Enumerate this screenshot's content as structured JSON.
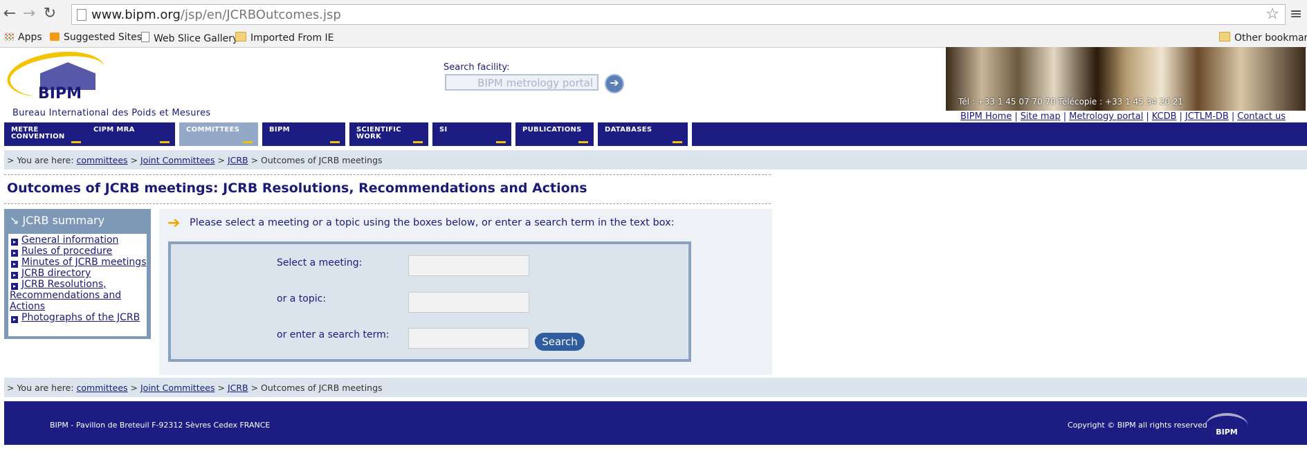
{
  "browser": {
    "url_domain": "www.bipm.org",
    "url_path": "/jsp/en/JCRBOutcomes.jsp",
    "bookmarks": [
      "Apps",
      "Suggested Sites",
      "Web Slice Gallery",
      "Imported From IE"
    ],
    "other_bookmarks": "Other bookmarks"
  },
  "header": {
    "logo_text": "BIPM",
    "bureau_name": "Bureau International des Poids et Mesures",
    "search_label": "Search facility:",
    "search_placeholder": "BIPM metrology portal",
    "banner_contact": "Tél : +33 1 45 07 70 70  Télécopie : +33 1 45 34 20 21",
    "top_links": [
      "BIPM Home",
      "Site map",
      "Metrology portal",
      "KCDB",
      "JCTLM-DB",
      "Contact us"
    ]
  },
  "nav": {
    "items": [
      "METRE\nCONVENTION",
      "CIPM MRA",
      "COMMITTEES",
      "BIPM",
      "SCIENTIFIC\nWORK",
      "SI",
      "PUBLICATIONS",
      "DATABASES"
    ],
    "active": "COMMITTEES"
  },
  "breadcrumb": {
    "prefix": "> You are here:",
    "links": [
      "committees",
      "Joint Committees",
      "JCRB"
    ],
    "current": "Outcomes of JCRB meetings"
  },
  "page_title": "Outcomes of JCRB meetings: JCRB Resolutions, Recommendations and Actions",
  "sidebar": {
    "title": "JCRB summary",
    "items": [
      "General information",
      "Rules of procedure",
      "Minutes of JCRB meetings",
      "JCRB directory",
      "JCRB Resolutions, Recommendations and Actions",
      "Photographs of the JCRB"
    ]
  },
  "main": {
    "instruction": "Please select a meeting or a topic using the boxes below, or enter a search term in the text box:",
    "meeting_label": "Select a meeting:",
    "topic_label": "or a topic:",
    "term_label": "or enter a search term:",
    "meeting_value": "",
    "topic_value": "",
    "term_value": "",
    "search_button": "Search"
  },
  "footer": {
    "address": "BIPM - Pavillon de Breteuil F-92312 Sèvres Cedex  FRANCE",
    "copyright": "Copyright © BIPM  all rights reserved",
    "logo_text": "BIPM"
  }
}
